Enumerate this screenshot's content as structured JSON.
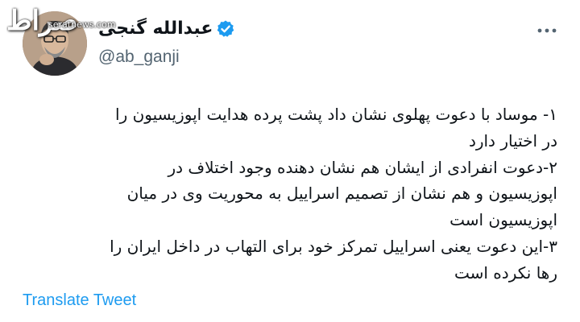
{
  "watermark": {
    "logo": "صراط",
    "site": "seratnews.com"
  },
  "author": {
    "display_name": "عبدالله گنجی",
    "handle": "@ab_ganji",
    "verified_icon": "verified-badge-icon"
  },
  "tweet": {
    "lines": [
      "۱- موساد با دعوت پهلوی نشان داد پشت پرده هدایت اپوزیسیون را",
      "در اختیار دارد",
      "۲-دعوت انفرادی از ایشان هم نشان دهنده وجود اختلاف در",
      "اپوزیسیون و هم نشان از تصمیم اسراییل به محوریت وی در میان",
      "اپوزیسیون است",
      "۳-این دعوت یعنی اسراییل تمرکز خود برای التهاب در داخل ایران را",
      "رها نکرده است"
    ],
    "translate_label": "Translate Tweet"
  },
  "colors": {
    "verified": "#1d9bf0",
    "link": "#1d9bf0",
    "secondary": "#536471"
  }
}
